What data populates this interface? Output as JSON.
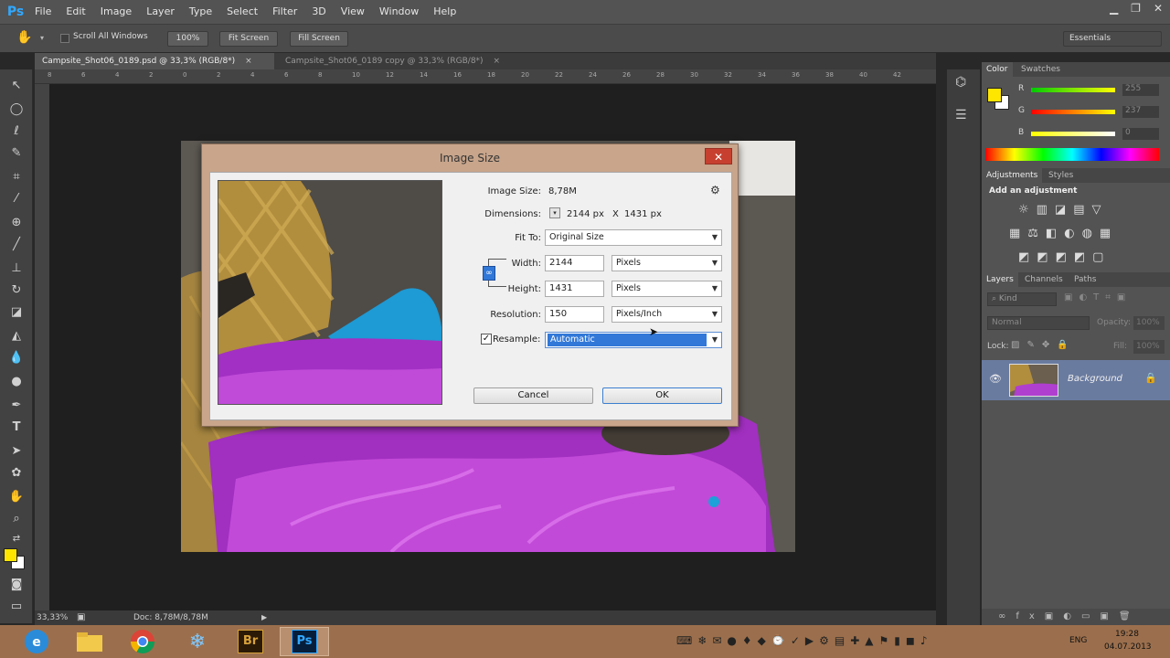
{
  "menu": {
    "logo": "Ps",
    "items": [
      "File",
      "Edit",
      "Image",
      "Layer",
      "Type",
      "Select",
      "Filter",
      "3D",
      "View",
      "Window",
      "Help"
    ]
  },
  "options": {
    "scroll_all": "Scroll All Windows",
    "zoom_100": "100%",
    "fit_screen": "Fit Screen",
    "fill_screen": "Fill Screen",
    "workspace": "Essentials"
  },
  "tabs": [
    {
      "label": "Campsite_Shot06_0189.psd @ 33,3% (RGB/8*)"
    },
    {
      "label": "Campsite_Shot06_0189 copy @ 33,3% (RGB/8*)"
    }
  ],
  "ruler_ticks": [
    "8",
    "6",
    "4",
    "2",
    "0",
    "2",
    "4",
    "6",
    "8",
    "10",
    "12",
    "14",
    "16",
    "18",
    "20",
    "22",
    "24",
    "26",
    "28",
    "30",
    "32",
    "34",
    "36",
    "38",
    "40",
    "42"
  ],
  "status": {
    "zoom": "33,33%",
    "doc": "Doc: 8,78M/8,78M"
  },
  "panels": {
    "color_tab": "Color",
    "swatches_tab": "Swatches",
    "color_values": {
      "r_label": "R",
      "g_label": "G",
      "b_label": "B",
      "r": "255",
      "g": "237",
      "b": "0"
    },
    "adjustments_tab": "Adjustments",
    "styles_tab": "Styles",
    "add_adjustment": "Add an adjustment",
    "layers_tab": "Layers",
    "channels_tab": "Channels",
    "paths_tab": "Paths",
    "kind": "Kind",
    "blend_mode": "Normal",
    "opacity_label": "Opacity:",
    "opacity": "100%",
    "lock_label": "Lock:",
    "fill_label": "Fill:",
    "fill": "100%",
    "layer_name": "Background"
  },
  "dialog": {
    "title": "Image Size",
    "close": "✕",
    "image_size_label": "Image Size:",
    "image_size_value": "8,78M",
    "dimensions_label": "Dimensions:",
    "dimensions_w": "2144 px",
    "dimensions_x": "X",
    "dimensions_h": "1431 px",
    "fit_to_label": "Fit To:",
    "fit_to_value": "Original Size",
    "width_label": "Width:",
    "width_value": "2144",
    "width_unit": "Pixels",
    "height_label": "Height:",
    "height_value": "1431",
    "height_unit": "Pixels",
    "resolution_label": "Resolution:",
    "resolution_value": "150",
    "resolution_unit": "Pixels/Inch",
    "resample_label": "Resample:",
    "resample_value": "Automatic",
    "cancel": "Cancel",
    "ok": "OK"
  },
  "taskbar": {
    "icons": [
      "windows-icon",
      "explorer-icon",
      "chrome-icon",
      "snowflake-icon",
      "bridge-icon",
      "photoshop-icon"
    ],
    "br": "Br",
    "ps": "Ps",
    "lang": "ENG",
    "time": "19:28",
    "date": "04.07.2013"
  },
  "colors": {
    "foreground": "#ffe600",
    "background": "#ffffff",
    "ps_blue": "#31a8ff",
    "selection": "#3178d8"
  }
}
